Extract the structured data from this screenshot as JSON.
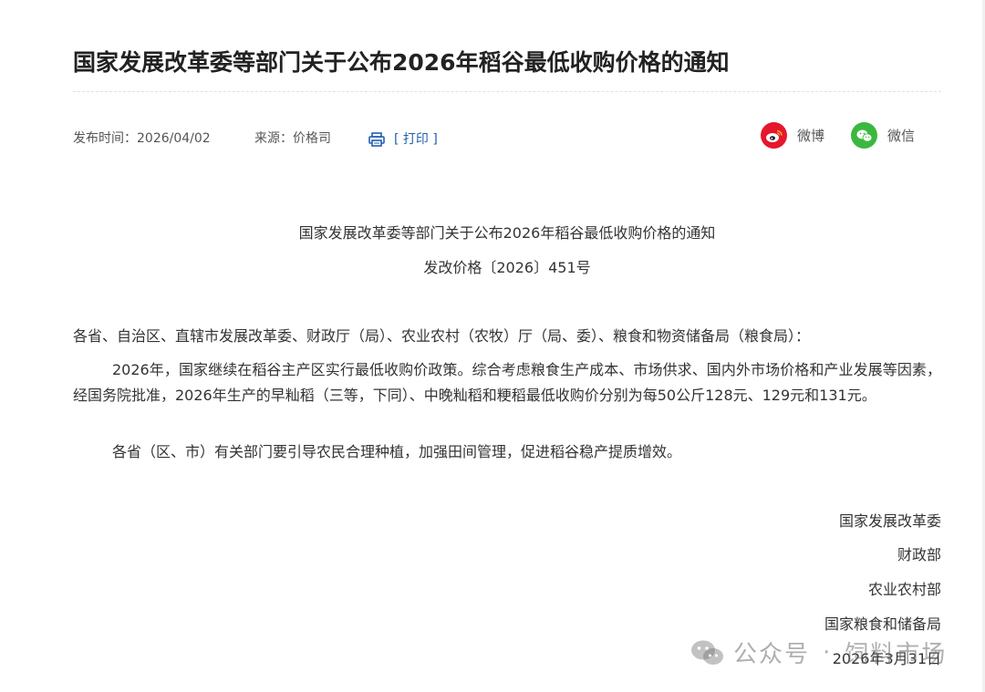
{
  "article": {
    "title": "国家发展改革委等部门关于公布2026年稻谷最低收购价格的通知"
  },
  "meta": {
    "date": "发布时间：2026/04/02",
    "source": "来源：价格司",
    "print_label": "[ 打印 ]"
  },
  "share": {
    "weibo_label": "微博",
    "wechat_label": "微信"
  },
  "document": {
    "heading": "国家发展改革委等部门关于公布2026年稻谷最低收购价格的通知",
    "doc_number": "发改价格〔2026〕451号",
    "addressee": "各省、自治区、直辖市发展改革委、财政厅（局）、农业农村（农牧）厅（局、委）、粮食和物资储备局（粮食局）：",
    "paragraph1": "2026年，国家继续在稻谷主产区实行最低收购价政策。综合考虑粮食生产成本、市场供求、国内外市场价格和产业发展等因素，经国务院批准，2026年生产的早籼稻（三等，下同）、中晚籼稻和粳稻最低收购价分别为每50公斤128元、129元和131元。",
    "paragraph2": "各省（区、市）有关部门要引导农民合理种植，加强田间管理，促进稻谷稳产提质增效。"
  },
  "signatures": {
    "org1": "国家发展改革委",
    "org2": "财政部",
    "org3": "农业农村部",
    "org4": "国家粮食和储备局",
    "date": "2026年3月31日"
  },
  "watermark": {
    "platform": "公众号",
    "account": "饲料市场"
  },
  "colors": {
    "link": "#1f5fb3",
    "weibo": "#e6162d",
    "wechat": "#3bb83f"
  },
  "icons": {
    "print": "printer-icon",
    "weibo": "weibo-icon",
    "wechat": "wechat-icon"
  }
}
